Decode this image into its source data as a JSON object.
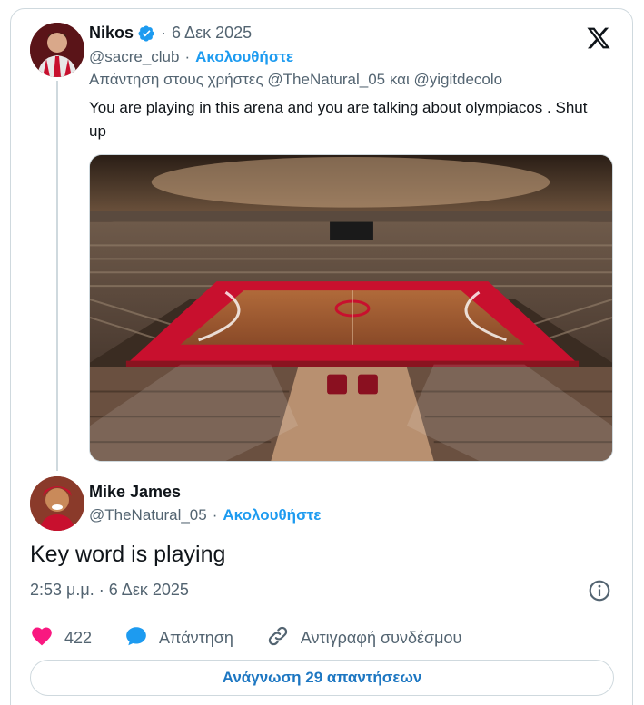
{
  "parent": {
    "name": "Nikos",
    "dot": "·",
    "date": "6 Δεκ 2025",
    "handle": "@sacre_club",
    "follow_dot": "·",
    "follow": "Ακολουθήστε",
    "reply_prefix": "Απάντηση στους χρήστες",
    "reply_user_1": "@TheNatural_05",
    "reply_and": "και",
    "reply_user_2": "@yigitdecolo",
    "text": "You are playing in this arena and you are talking about olympiacos . Shut up",
    "verified_icon": "verified-badge-icon"
  },
  "reply": {
    "name": "Mike James",
    "handle": "@TheNatural_05",
    "follow_dot": "·",
    "follow": "Ακολουθήστε",
    "text": "Key word is playing",
    "timestamp": "2:53 μ.μ. · 6 Δεκ 2025"
  },
  "actions": {
    "likes": "422",
    "reply_label": "Απάντηση",
    "copy_link_label": "Αντιγραφή συνδέσμου"
  },
  "read_replies_label": "Ανάγνωση 29 απαντήσεων",
  "colors": {
    "accent": "#1d9bf0",
    "like": "#f91880",
    "text_secondary": "#536471"
  }
}
